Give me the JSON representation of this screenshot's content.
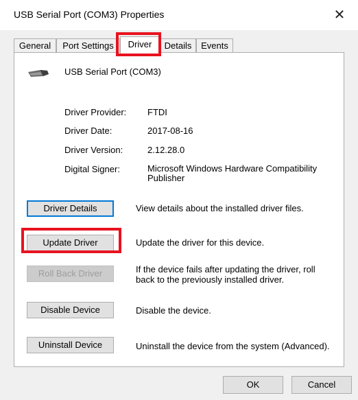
{
  "window": {
    "title": "USB Serial Port (COM3) Properties",
    "close_label": "✕"
  },
  "tabs": [
    {
      "label": "General"
    },
    {
      "label": "Port Settings"
    },
    {
      "label": "Driver",
      "active": true
    },
    {
      "label": "Details"
    },
    {
      "label": "Events"
    }
  ],
  "device": {
    "name": "USB Serial Port (COM3)",
    "icon": "usb-connector-icon"
  },
  "info": [
    {
      "label": "Driver Provider:",
      "value": "FTDI"
    },
    {
      "label": "Driver Date:",
      "value": "2017-08-16"
    },
    {
      "label": "Driver Version:",
      "value": "2.12.28.0"
    },
    {
      "label": "Digital Signer:",
      "value": "Microsoft Windows Hardware Compatibility Publisher"
    }
  ],
  "actions": [
    {
      "button": "Driver Details",
      "description": "View details about the installed driver files."
    },
    {
      "button": "Update Driver",
      "description": "Update the driver for this device."
    },
    {
      "button": "Roll Back Driver",
      "description": "If the device fails after updating the driver, roll back to the previously installed driver.",
      "disabled": true
    },
    {
      "button": "Disable Device",
      "description": "Disable the device."
    },
    {
      "button": "Uninstall Device",
      "description": "Uninstall the device from the system (Advanced)."
    }
  ],
  "footer": {
    "ok_label": "OK",
    "cancel_label": "Cancel"
  },
  "colors": {
    "highlight": "#e8131f",
    "focus_border": "#0078d7"
  }
}
